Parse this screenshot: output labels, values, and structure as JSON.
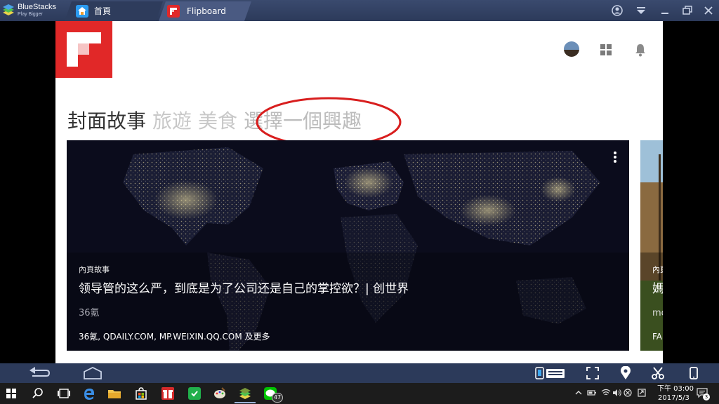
{
  "bluestacks": {
    "brand": "BlueStacks",
    "tagline": "Play Bigger",
    "tabs": [
      {
        "label": "首頁"
      },
      {
        "label": "Flipboard"
      }
    ]
  },
  "flipboard": {
    "topics": [
      {
        "label": "封面故事"
      },
      {
        "label": "旅遊"
      },
      {
        "label": "美食"
      },
      {
        "label": "選擇一個興趣"
      }
    ],
    "cover_story": {
      "section": "內頁故事",
      "title": "领导管的这么严，到底是为了公司还是自己的掌控欲？| 创世界",
      "publisher": "36氪",
      "sources": "36氪, QDAILY.COM, MP.WEIXIN.QQ.COM 及更多"
    },
    "next_card": {
      "section": "內頁",
      "title": "媽",
      "publisher": "mo",
      "sources": "FA"
    }
  },
  "taskbar": {
    "badge": "47",
    "clock_time": "下午 03:00",
    "clock_date": "2017/5/3",
    "notif_count": "3"
  },
  "colors": {
    "flipboard_red": "#e12828",
    "annotation_red": "#d81e1e",
    "bluestacks_bar": "#2c3a5a"
  }
}
